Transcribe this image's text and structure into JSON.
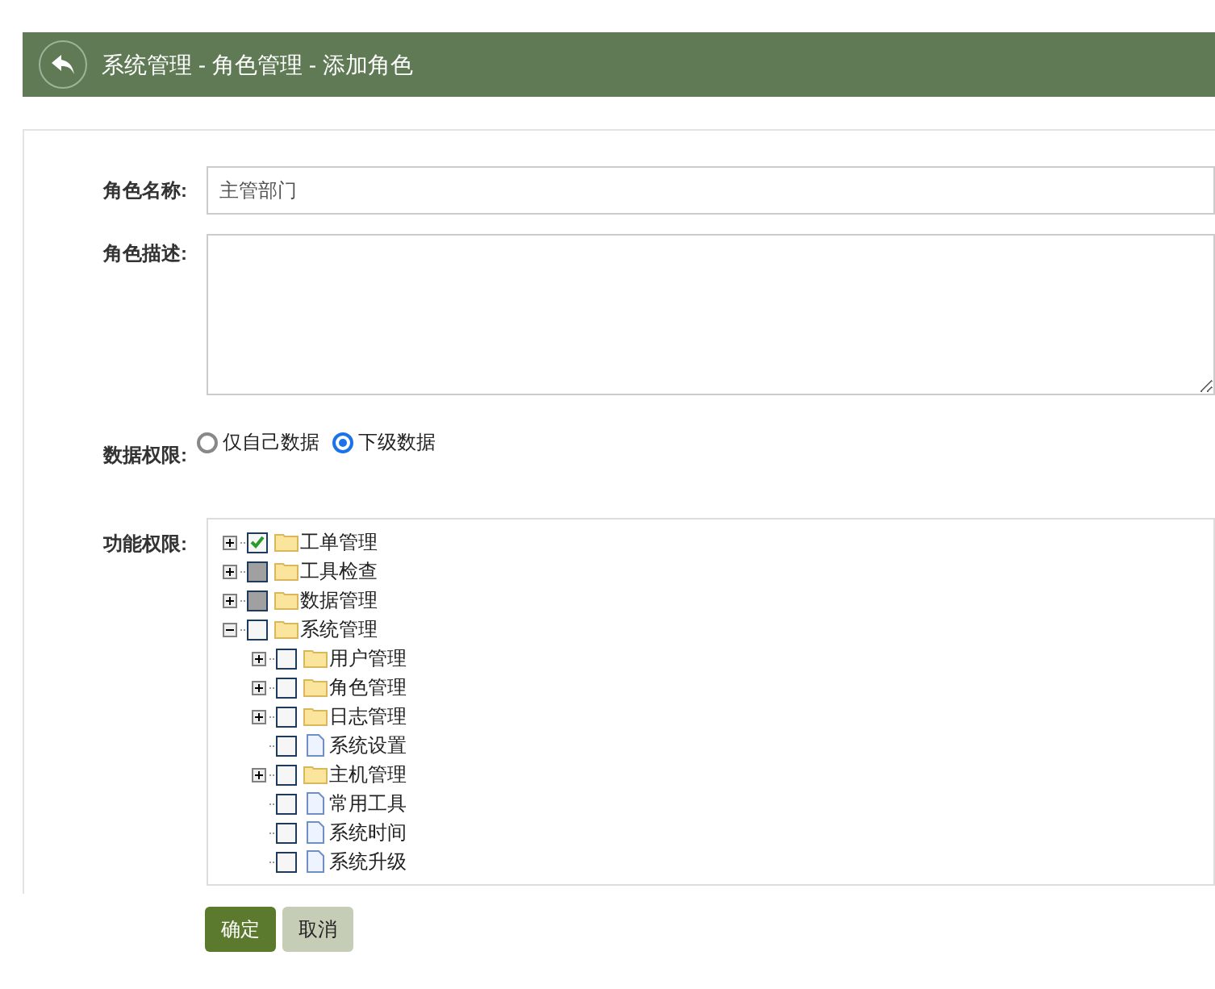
{
  "header": {
    "title": "系统管理 - 角色管理 - 添加角色"
  },
  "form": {
    "name": {
      "label": "角色名称:",
      "value": "主管部门"
    },
    "description": {
      "label": "角色描述:"
    },
    "data_scope": {
      "label": "数据权限:",
      "options": [
        {
          "label": "仅自己数据",
          "selected": false
        },
        {
          "label": "下级数据",
          "selected": true
        }
      ]
    },
    "permissions": {
      "label": "功能权限:",
      "tree": [
        {
          "label": "工单管理",
          "kind": "folder",
          "expanded": false,
          "checked": true,
          "partial": false
        },
        {
          "label": "工具检查",
          "kind": "folder",
          "expanded": false,
          "checked": false,
          "partial": true
        },
        {
          "label": "数据管理",
          "kind": "folder",
          "expanded": false,
          "checked": false,
          "partial": true
        },
        {
          "label": "系统管理",
          "kind": "folder",
          "expanded": true,
          "checked": false,
          "partial": false,
          "children": [
            {
              "label": "用户管理",
              "kind": "folder",
              "expanded": false,
              "checked": false,
              "partial": false
            },
            {
              "label": "角色管理",
              "kind": "folder",
              "expanded": false,
              "checked": false,
              "partial": false
            },
            {
              "label": "日志管理",
              "kind": "folder",
              "expanded": false,
              "checked": false,
              "partial": false
            },
            {
              "label": "系统设置",
              "kind": "file",
              "checked": false,
              "partial": false
            },
            {
              "label": "主机管理",
              "kind": "folder",
              "expanded": false,
              "checked": false,
              "partial": false
            },
            {
              "label": "常用工具",
              "kind": "file",
              "checked": false,
              "partial": false
            },
            {
              "label": "系统时间",
              "kind": "file",
              "checked": false,
              "partial": false
            },
            {
              "label": "系统升级",
              "kind": "file",
              "checked": false,
              "partial": false
            }
          ]
        }
      ]
    }
  },
  "buttons": [
    {
      "label": "确定",
      "kind": "primary"
    },
    {
      "label": "取消",
      "kind": "secondary"
    }
  ]
}
